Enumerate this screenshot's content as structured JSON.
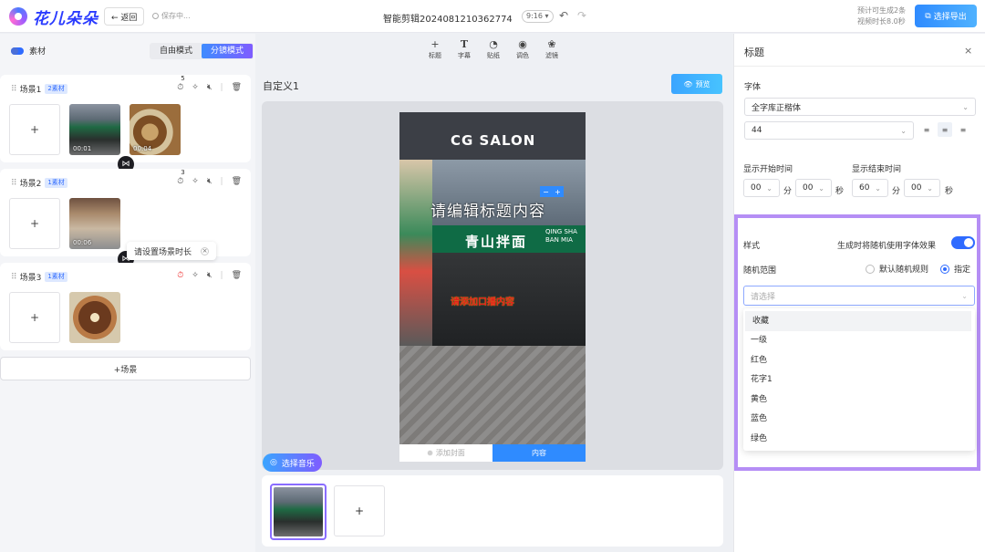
{
  "app": {
    "logo_text": "花儿朵朵",
    "back_label": "← 返回",
    "save_status": "保存中...",
    "project_title": "智能剪辑2024081210362774",
    "ratio": "9:16 ▾",
    "estimate_line1": "预计可生成2条",
    "estimate_line2": "视频时长8.0秒",
    "export_label": "选择导出"
  },
  "left": {
    "material_label": "素材",
    "modes": [
      "自由模式",
      "分镜模式"
    ],
    "scenes": [
      {
        "name": "场景1",
        "badge": "2素材",
        "timer_count": "5",
        "clips": [
          "00:01",
          "00:04"
        ]
      },
      {
        "name": "场景2",
        "badge": "1素材",
        "timer_count": "3",
        "clips": [
          "00:06"
        ]
      },
      {
        "name": "场景3",
        "badge": "1素材",
        "timer_count": "",
        "clips": [
          ""
        ]
      }
    ],
    "tooltip": "请设置场景时长",
    "add_scene": "+场景"
  },
  "center": {
    "tools": [
      {
        "icon": "plus-icon",
        "label": "标题"
      },
      {
        "icon": "text-icon",
        "label": "字幕"
      },
      {
        "icon": "sticker-icon",
        "label": "贴纸"
      },
      {
        "icon": "palette-icon",
        "label": "调色"
      },
      {
        "icon": "filter-icon",
        "label": "滤镜"
      }
    ],
    "canvas_title": "自定义1",
    "preview_label": "预览",
    "sign_text": "CG SALON",
    "shop_sign": "青山拌面",
    "shop_sign_side": "QING SHA BAN MIA",
    "title_placeholder": "请编辑标题内容",
    "subtitle_placeholder": "请添加口播内容",
    "add_cover": "添加封面",
    "content_tab": "内容",
    "music_label": "选择音乐"
  },
  "right": {
    "panel_title": "标题",
    "font_label": "字体",
    "font_value": "全字库正楷体",
    "size_value": "44",
    "start_label": "显示开始时间",
    "end_label": "显示结束时间",
    "start_min": "00",
    "start_sec": "00",
    "end_min": "60",
    "end_sec": "00",
    "unit_min": "分",
    "unit_sec": "秒",
    "style_label": "样式",
    "random_font_label": "生成时将随机使用字体效果",
    "random_range_label": "随机范围",
    "radio_default": "默认随机规则",
    "radio_specified": "指定",
    "select_placeholder": "请选择",
    "options": [
      "收藏",
      "一级",
      "红色",
      "花字1",
      "黄色",
      "蓝色",
      "绿色"
    ]
  },
  "colors": {
    "accent": "#2f6bff",
    "highlight": "#b58ef5",
    "alert": "#e33333"
  }
}
